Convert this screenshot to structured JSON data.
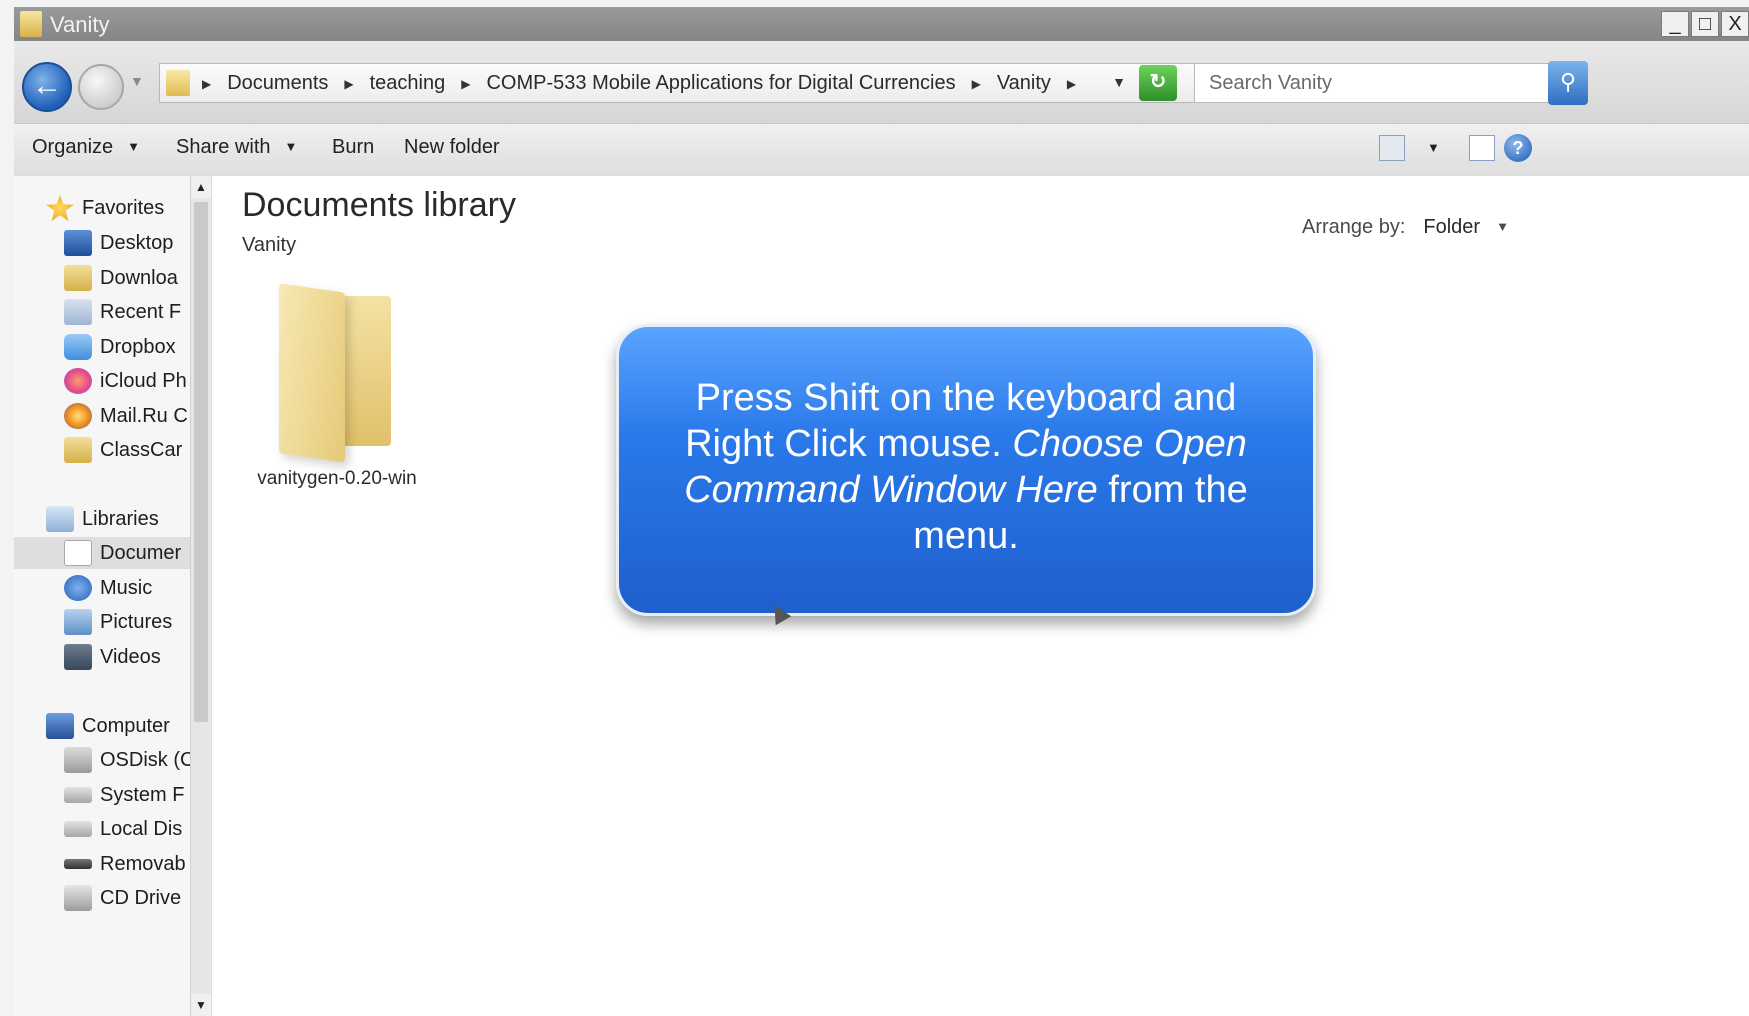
{
  "window": {
    "title": "Vanity",
    "buttons": {
      "minimize": "_",
      "maximize": "□",
      "close": "X"
    }
  },
  "address": {
    "crumbs": [
      "Documents",
      "teaching",
      "COMP-533 Mobile Applications for Digital Currencies",
      "Vanity"
    ],
    "search_placeholder": "Search Vanity"
  },
  "toolbar": {
    "organize": "Organize",
    "share_with": "Share with",
    "burn": "Burn",
    "new_folder": "New folder",
    "help": "?"
  },
  "nav": {
    "favorites_header": "Favorites",
    "favorites": [
      "Desktop",
      "Downloa",
      "Recent F",
      "Dropbox",
      "iCloud Ph",
      "Mail.Ru C",
      "ClassCar"
    ],
    "libraries_header": "Libraries",
    "libraries": [
      "Documer",
      "Music",
      "Pictures",
      "Videos"
    ],
    "computer_header": "Computer",
    "computer": [
      "OSDisk (C",
      "System F",
      "Local Dis",
      "Removab",
      "CD Drive"
    ]
  },
  "content": {
    "title": "Documents library",
    "subtitle": "Vanity",
    "arrange_label": "Arrange by:",
    "arrange_value": "Folder",
    "files": [
      {
        "name": "vanitygen-0.20-win"
      }
    ]
  },
  "callout": {
    "line1": "Press Shift on the keyboard and Right Click mouse.",
    "italic": "Choose Open Command Window Here",
    "line2": "from the menu."
  },
  "colors": {
    "callout": "#2a79ea",
    "titlebar": "#8f8f8f",
    "selection": "#dedede"
  }
}
